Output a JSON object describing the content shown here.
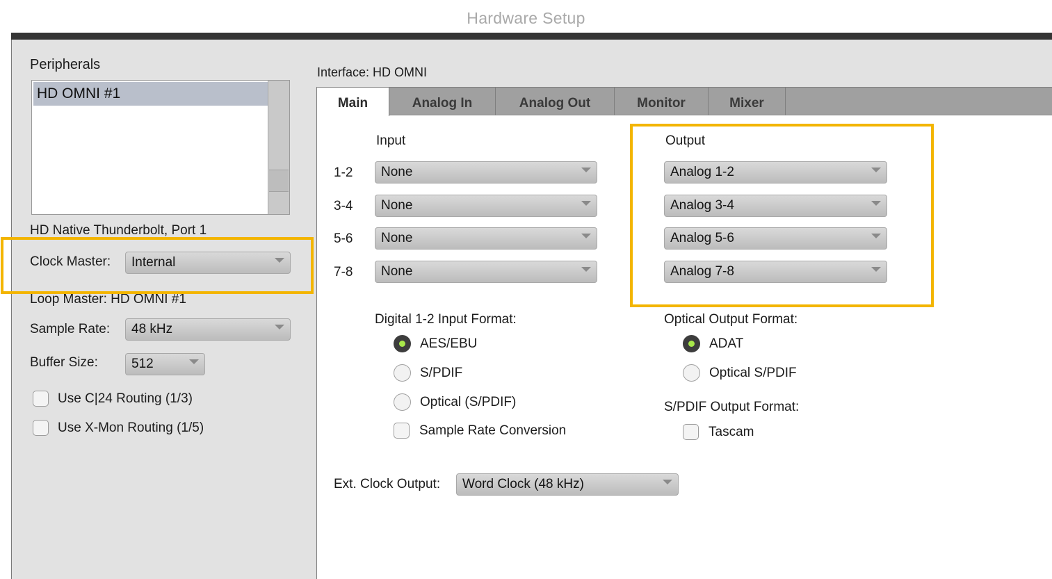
{
  "window": {
    "title": "Hardware Setup"
  },
  "sidebar": {
    "peripherals_label": "Peripherals",
    "peripherals": [
      "HD OMNI #1"
    ],
    "port_label": "HD Native Thunderbolt, Port 1",
    "clock_master": {
      "label": "Clock Master:",
      "value": "Internal"
    },
    "loop_master": "Loop Master: HD OMNI #1",
    "sample_rate": {
      "label": "Sample Rate:",
      "value": "48 kHz"
    },
    "buffer_size": {
      "label": "Buffer Size:",
      "value": "512"
    },
    "checkboxes": [
      {
        "label": "Use C|24 Routing (1/3)",
        "checked": false
      },
      {
        "label": "Use X-Mon Routing (1/5)",
        "checked": false
      }
    ]
  },
  "main": {
    "interface_label": "Interface: HD OMNI",
    "tabs": [
      "Main",
      "Analog In",
      "Analog Out",
      "Monitor",
      "Mixer"
    ],
    "active_tab": "Main",
    "input_header": "Input",
    "output_header": "Output",
    "channel_rows": [
      {
        "label": "1-2",
        "input": "None",
        "output": "Analog 1-2"
      },
      {
        "label": "3-4",
        "input": "None",
        "output": "Analog 3-4"
      },
      {
        "label": "5-6",
        "input": "None",
        "output": "Analog 5-6"
      },
      {
        "label": "7-8",
        "input": "None",
        "output": "Analog 7-8"
      }
    ],
    "digital_input_format": {
      "label": "Digital 1-2 Input Format:",
      "options": [
        "AES/EBU",
        "S/PDIF",
        "Optical (S/PDIF)"
      ],
      "selected": "AES/EBU"
    },
    "sample_rate_conversion": {
      "label": "Sample Rate Conversion",
      "checked": false
    },
    "optical_output_format": {
      "label": "Optical Output Format:",
      "options": [
        "ADAT",
        "Optical S/PDIF"
      ],
      "selected": "ADAT"
    },
    "spdif_output_format": {
      "label": "S/PDIF Output Format:",
      "option": "Tascam",
      "checked": false
    },
    "ext_clock_output": {
      "label": "Ext. Clock Output:",
      "value": "Word Clock (48 kHz)"
    }
  },
  "colors": {
    "highlight": "#f3b500",
    "radio_selected": "#a8e84a"
  }
}
